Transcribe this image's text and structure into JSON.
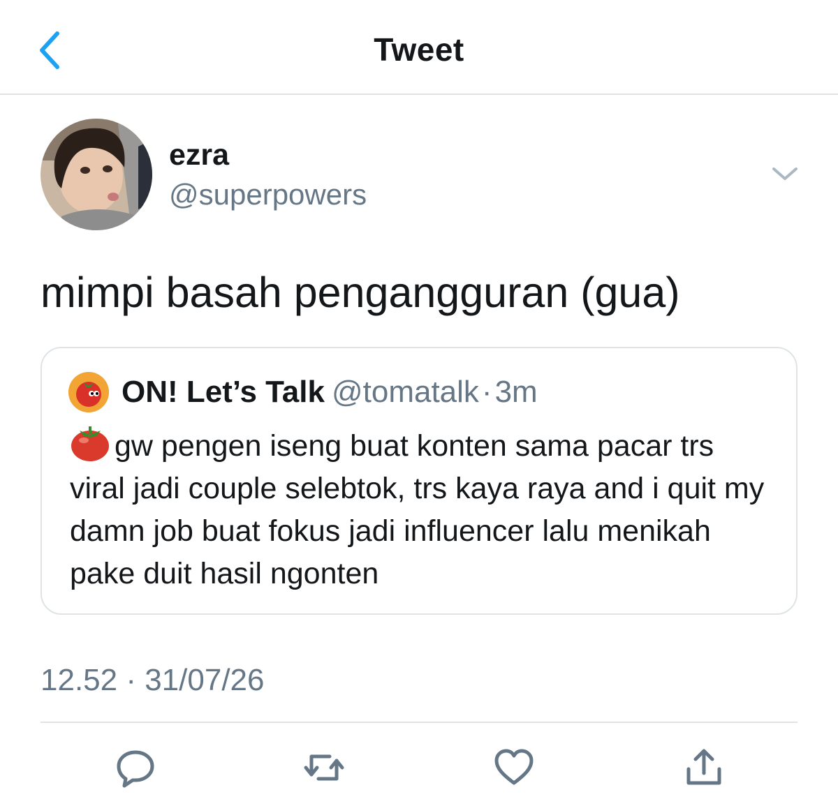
{
  "header": {
    "title": "Tweet",
    "back_icon": "chevron-left-icon"
  },
  "tweet": {
    "author_name": "ezra",
    "author_handle": "@superpowers",
    "text": "mimpi basah pengangguran (gua)",
    "timestamp": "12.52 · 31/07/26",
    "menu_icon": "chevron-down-icon"
  },
  "quote": {
    "name": "ON! Let’s Talk",
    "handle": "@tomatalk",
    "separator": "·",
    "time": "3m",
    "body": "gw pengen iseng buat konten sama pacar trs viral jadi couple selebtok, trs kaya raya and i quit my damn job buat fokus jadi influencer lalu menikah pake duit hasil ngonten",
    "leading_emoji": "tomato-emoji"
  },
  "actions": [
    "reply-icon",
    "retweet-icon",
    "like-icon",
    "share-icon"
  ],
  "colors": {
    "accent": "#1da1f2",
    "secondary_text": "#657786",
    "border": "#dfe3e6",
    "icon": "#657786"
  }
}
